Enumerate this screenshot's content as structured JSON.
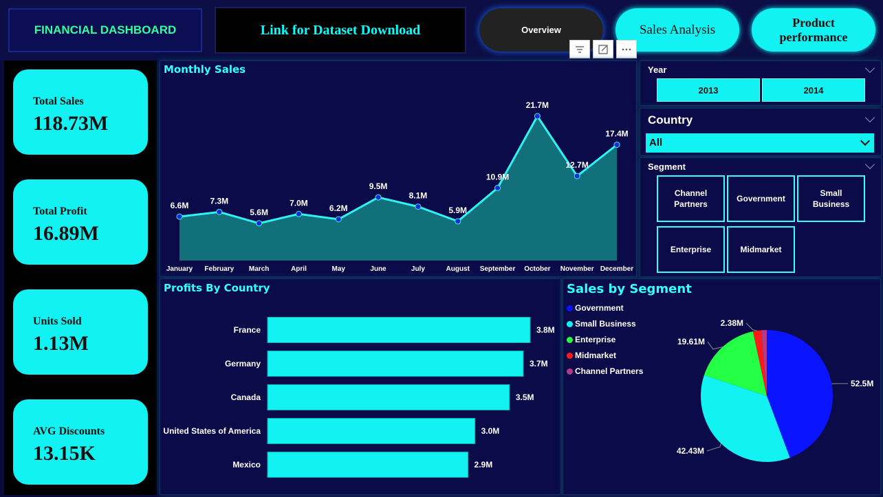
{
  "header": {
    "title": "FINANCIAL DASHBOARD",
    "link_label": "Link for Dataset Download",
    "nav": {
      "overview": "Overview",
      "sales": "Sales Analysis",
      "product": "Product performance"
    },
    "toolbar_icons": [
      "filter-icon",
      "focus-mode-icon",
      "more-options-icon"
    ]
  },
  "kpis": [
    {
      "label": "Total Sales",
      "value": "118.73M"
    },
    {
      "label": "Total Profit",
      "value": "16.89M"
    },
    {
      "label": "Units Sold",
      "value": "1.13M"
    },
    {
      "label": "AVG Discounts",
      "value": "13.15K"
    }
  ],
  "monthly_sales": {
    "title": "Monthly Sales"
  },
  "profits_by_country": {
    "title": "Profits By Country"
  },
  "sales_by_segment": {
    "title": "Sales by Segment"
  },
  "filters": {
    "year": {
      "title": "Year",
      "options": [
        "2013",
        "2014"
      ]
    },
    "country": {
      "title": "Country",
      "selected": "All"
    },
    "segment": {
      "title": "Segment",
      "options": [
        "Channel Partners",
        "Government",
        "Small Business",
        "Enterprise",
        "Midmarket"
      ]
    }
  },
  "colors": {
    "accent": "#12f2f2",
    "background": "#0a0b3d",
    "government": "#0a14ff",
    "small_business": "#12f2f2",
    "enterprise": "#22ff44",
    "midmarket": "#ff1a1a",
    "channel_partners": "#b23a8a"
  },
  "chart_data": [
    {
      "type": "area",
      "title": "Monthly Sales",
      "categories": [
        "January",
        "February",
        "March",
        "April",
        "May",
        "June",
        "July",
        "August",
        "September",
        "October",
        "November",
        "December"
      ],
      "values": [
        6.6,
        7.3,
        5.6,
        7.0,
        6.2,
        9.5,
        8.1,
        5.9,
        10.9,
        21.7,
        12.7,
        17.4
      ],
      "labels": [
        "6.6M",
        "7.3M",
        "5.6M",
        "7.0M",
        "6.2M",
        "9.5M",
        "8.1M",
        "5.9M",
        "10.9M",
        "21.7M",
        "12.7M",
        "17.4M"
      ],
      "unit": "M"
    },
    {
      "type": "bar",
      "orientation": "horizontal",
      "title": "Profits By Country",
      "categories": [
        "France",
        "Germany",
        "Canada",
        "United States of America",
        "Mexico"
      ],
      "values": [
        3.8,
        3.7,
        3.5,
        3.0,
        2.9
      ],
      "labels": [
        "3.8M",
        "3.7M",
        "3.5M",
        "3.0M",
        "2.9M"
      ],
      "unit": "M"
    },
    {
      "type": "pie",
      "title": "Sales by Segment",
      "series": [
        {
          "name": "Government",
          "value": 52.5,
          "label": "52.5M"
        },
        {
          "name": "Small Business",
          "value": 42.43,
          "label": "42.43M"
        },
        {
          "name": "Enterprise",
          "value": 19.61,
          "label": "19.61M"
        },
        {
          "name": "Midmarket",
          "value": 2.38,
          "label": "2.38M"
        },
        {
          "name": "Channel Partners",
          "value": 1.6,
          "label": ""
        }
      ],
      "legend": "top-left"
    }
  ]
}
